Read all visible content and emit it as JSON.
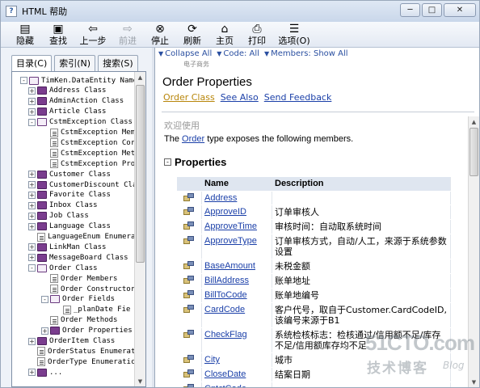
{
  "window": {
    "title": "HTML 帮助",
    "controls": [
      "─",
      "□",
      "✕"
    ]
  },
  "toolbar": {
    "items": [
      {
        "label": "隐藏",
        "icon": "hide-icon",
        "enabled": true
      },
      {
        "label": "查找",
        "icon": "locate-icon",
        "enabled": true
      },
      {
        "label": "上一步",
        "icon": "back-arrow-icon",
        "enabled": true
      },
      {
        "label": "前进",
        "icon": "forward-arrow-icon",
        "enabled": false
      },
      {
        "label": "停止",
        "icon": "stop-icon",
        "enabled": true
      },
      {
        "label": "刷新",
        "icon": "refresh-icon",
        "enabled": true
      },
      {
        "label": "主页",
        "icon": "home-icon",
        "enabled": true
      },
      {
        "label": "打印",
        "icon": "print-icon",
        "enabled": true
      },
      {
        "label": "选项(O)",
        "icon": "options-icon",
        "enabled": true
      }
    ]
  },
  "left_tabs": [
    "目录(C)",
    "索引(N)",
    "搜索(S)"
  ],
  "tree": [
    {
      "label": "TimKen.DataEntity Names",
      "level": 0,
      "kind": "book-open",
      "toggle": "-"
    },
    {
      "label": "Address Class",
      "level": 1,
      "kind": "book",
      "toggle": "+"
    },
    {
      "label": "AdminAction Class",
      "level": 1,
      "kind": "book",
      "toggle": "+"
    },
    {
      "label": "Article Class",
      "level": 1,
      "kind": "book",
      "toggle": "+"
    },
    {
      "label": "CstmException Class",
      "level": 1,
      "kind": "book-open",
      "toggle": "-"
    },
    {
      "label": "CstmException Mem",
      "level": 2,
      "kind": "page",
      "toggle": ""
    },
    {
      "label": "CstmException Cor",
      "level": 2,
      "kind": "page",
      "toggle": ""
    },
    {
      "label": "CstmException Met",
      "level": 2,
      "kind": "page",
      "toggle": ""
    },
    {
      "label": "CstmException Pro",
      "level": 2,
      "kind": "page",
      "toggle": ""
    },
    {
      "label": "Customer Class",
      "level": 1,
      "kind": "book",
      "toggle": "+"
    },
    {
      "label": "CustomerDiscount Cla",
      "level": 1,
      "kind": "book",
      "toggle": "+"
    },
    {
      "label": "Favorite Class",
      "level": 1,
      "kind": "book",
      "toggle": "+"
    },
    {
      "label": "Inbox Class",
      "level": 1,
      "kind": "book",
      "toggle": "+"
    },
    {
      "label": "Job Class",
      "level": 1,
      "kind": "book",
      "toggle": "+"
    },
    {
      "label": "Language Class",
      "level": 1,
      "kind": "book",
      "toggle": "+"
    },
    {
      "label": "LanguageEnum Enumera",
      "level": 1,
      "kind": "page",
      "toggle": ""
    },
    {
      "label": "LinkMan Class",
      "level": 1,
      "kind": "book",
      "toggle": "+"
    },
    {
      "label": "MessageBoard Class",
      "level": 1,
      "kind": "book",
      "toggle": "+"
    },
    {
      "label": "Order Class",
      "level": 1,
      "kind": "book-open",
      "toggle": "-"
    },
    {
      "label": "Order Members",
      "level": 2,
      "kind": "page",
      "toggle": ""
    },
    {
      "label": "Order Constructor",
      "level": 2,
      "kind": "page",
      "toggle": ""
    },
    {
      "label": "Order Fields",
      "level": 2,
      "kind": "book-open",
      "toggle": "-"
    },
    {
      "label": "_planDate Fie",
      "level": 3,
      "kind": "page",
      "toggle": ""
    },
    {
      "label": "Order Methods",
      "level": 2,
      "kind": "page",
      "toggle": ""
    },
    {
      "label": "Order Properties",
      "level": 2,
      "kind": "book",
      "toggle": "+"
    },
    {
      "label": "OrderItem Class",
      "level": 1,
      "kind": "book",
      "toggle": "+"
    },
    {
      "label": "OrderStatus Enumerat",
      "level": 1,
      "kind": "page",
      "toggle": ""
    },
    {
      "label": "OrderType Enumeratic",
      "level": 1,
      "kind": "page",
      "toggle": ""
    },
    {
      "label": "...",
      "level": 1,
      "kind": "book",
      "toggle": "+"
    }
  ],
  "navbar": {
    "collapse_all": "Collapse All",
    "code": "Code: All",
    "members": "Members: Show All",
    "small_text": "电子商务"
  },
  "page": {
    "title": "Order Properties",
    "links": [
      "Order Class",
      "See Also",
      "Send Feedback"
    ],
    "welcome": "欢迎使用",
    "intro_pre": "The ",
    "intro_link": "Order",
    "intro_post": " type exposes the following members.",
    "section": "Properties",
    "section_toggle": "-"
  },
  "properties": {
    "columns": [
      "",
      "Name",
      "Description"
    ],
    "rows": [
      {
        "name": "Address",
        "desc": ""
      },
      {
        "name": "ApproveID",
        "desc": "订单审核人"
      },
      {
        "name": "ApproveTime",
        "desc": "审核时间：自动取系统时间"
      },
      {
        "name": "ApproveType",
        "desc": "订单审核方式，自动/人工，来源于系统参数设置"
      },
      {
        "name": "BaseAmount",
        "desc": "未税金额"
      },
      {
        "name": "BillAddress",
        "desc": "账单地址"
      },
      {
        "name": "BillToCode",
        "desc": "账单地编号"
      },
      {
        "name": "CardCode",
        "desc": "客户代号，取自于Customer.CardCodeID,该编号来源于B1"
      },
      {
        "name": "CheckFlag",
        "desc": "系统检核标志：检核通过/信用额不足/库存不足/信用额库存均不足"
      },
      {
        "name": "City",
        "desc": "城市"
      },
      {
        "name": "CloseDate",
        "desc": "结案日期"
      },
      {
        "name": "CntctCode",
        "desc": ""
      }
    ]
  },
  "watermark": {
    "site": "51CTO.com",
    "cn": "技术博客",
    "blog": "Blog"
  }
}
